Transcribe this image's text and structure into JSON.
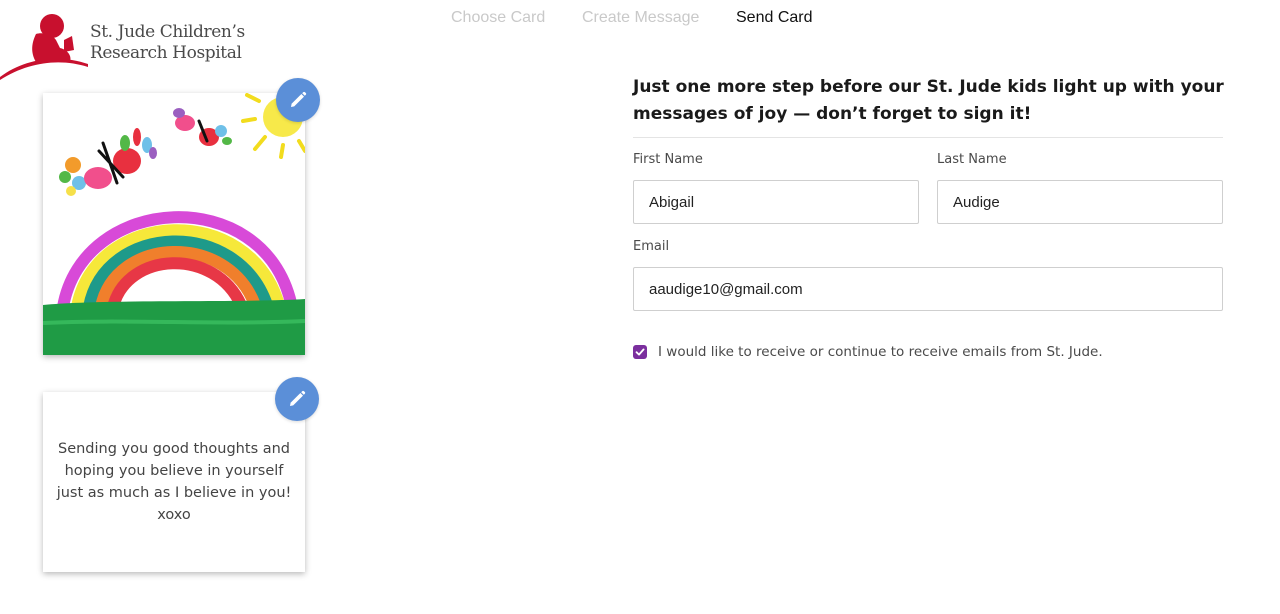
{
  "brand": {
    "logo_line1": "St. Jude Children’s",
    "logo_line2": "Research Hospital",
    "color": "#c8102e"
  },
  "steps": [
    {
      "label": "Choose Card",
      "active": false
    },
    {
      "label": "Create Message",
      "active": false
    },
    {
      "label": "Send Card",
      "active": true
    }
  ],
  "card": {
    "image_alt": "Child's drawing of a rainbow with butterflies and a sun",
    "message_lines": [
      "Sending you good thoughts and",
      "hoping you believe in yourself",
      "just as much as I believe in you!",
      "xoxo"
    ],
    "edit_icon": "pencil-icon",
    "edit_button_color": "#5b8fd8"
  },
  "form": {
    "heading_line1": "Just one more step before our St. Jude kids light up with your",
    "heading_line2": "messages of joy — don’t forget to sign it!",
    "first_name": {
      "label": "First Name",
      "value": "Abigail"
    },
    "last_name": {
      "label": "Last Name",
      "value": "Audige"
    },
    "email": {
      "label": "Email",
      "value": "aaudige10@gmail.com"
    },
    "optin": {
      "label": "I would like to receive or continue to receive emails from St. Jude.",
      "checked": true,
      "color": "#7b2f9e"
    }
  }
}
